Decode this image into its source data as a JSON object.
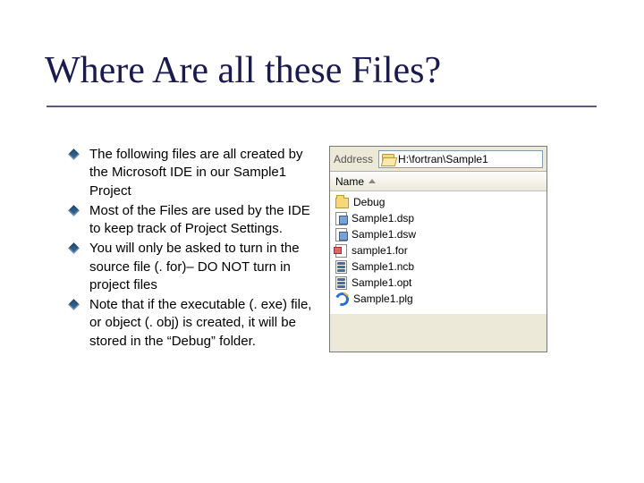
{
  "title": "Where Are all these Files?",
  "bullets": [
    "The following files are all created by the Microsoft IDE in our Sample1 Project",
    "Most of the Files are used by the IDE to keep track of Project Settings.",
    "You will only be asked to turn in the source file (. for)– DO NOT turn in project files",
    "Note that if the executable (. exe) file, or object (. obj) is created, it will be stored in the “Debug” folder."
  ],
  "explorer": {
    "address_label": "Address",
    "address_path": "H:\\fortran\\Sample1",
    "name_header": "Name",
    "files": [
      {
        "icon": "folder",
        "name": "Debug"
      },
      {
        "icon": "vs",
        "name": "Sample1.dsp"
      },
      {
        "icon": "vs",
        "name": "Sample1.dsw"
      },
      {
        "icon": "src",
        "name": "sample1.for"
      },
      {
        "icon": "db",
        "name": "Sample1.ncb"
      },
      {
        "icon": "db",
        "name": "Sample1.opt"
      },
      {
        "icon": "ie",
        "name": "Sample1.plg"
      }
    ]
  }
}
